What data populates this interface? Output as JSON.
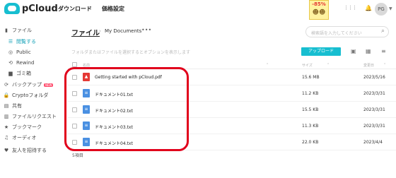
{
  "brand": {
    "logo_text": "pCloud"
  },
  "topnav": {
    "items": [
      "ダウンロード",
      "価格設定"
    ]
  },
  "promo": {
    "percent": "-85%",
    "faces": "☻☻"
  },
  "top_icons": {
    "apps": "⋮⋮⋮",
    "bell": "🔔",
    "help": "?"
  },
  "user": {
    "avatar_initials": "PG",
    "caret": "▼"
  },
  "sidebar": {
    "items": [
      {
        "label": "ファイル",
        "icon": "▮"
      },
      {
        "label": "閲覧する",
        "icon": "☰"
      },
      {
        "label": "Public",
        "icon": "◎"
      },
      {
        "label": "Rewind",
        "icon": "⟲"
      },
      {
        "label": "ゴミ箱",
        "icon": "▆"
      },
      {
        "label": "バックアップ",
        "icon": "⟳",
        "badge": "NEW"
      },
      {
        "label": "Cryptoフォルダ",
        "icon": "🔒"
      },
      {
        "label": "共有",
        "icon": "▤"
      },
      {
        "label": "ファイルリクエスト",
        "icon": "▥"
      },
      {
        "label": "ブックマーク",
        "icon": "★"
      },
      {
        "label": "オーディオ",
        "icon": "♫"
      },
      {
        "label": "友人を招待する",
        "icon": "♥"
      }
    ]
  },
  "breadcrumb": {
    "root": "ファイル",
    "separator": "›",
    "current": "My Documents",
    "more": "•••"
  },
  "search": {
    "placeholder": "検索語を入力してください",
    "icon": "⌕"
  },
  "toolbar": {
    "hint": "フォルダまたはファイルを選択するとオプションを表示します",
    "upload_label": "アップロード",
    "new_folder_icon": "▣",
    "grid_icon": "▦",
    "sort_icon": "≡"
  },
  "table": {
    "columns": {
      "name": "名前",
      "name_sort": "⌃",
      "size": "サイズ",
      "size_sort": "⌃",
      "modified": "変更日",
      "modified_sort": "⌃"
    },
    "rows": [
      {
        "icon": "pdf",
        "icon_glyph": "⬛",
        "name": "Getting started with pCloud.pdf",
        "size": "15.6 MB",
        "date": "2023/5/16"
      },
      {
        "icon": "txt",
        "icon_glyph": "≡",
        "name": "ドキュメント01.txt",
        "size": "11.2 KB",
        "date": "2023/3/31"
      },
      {
        "icon": "txt",
        "icon_glyph": "≡",
        "name": "ドキュメント02.txt",
        "size": "15.5 KB",
        "date": "2023/3/31"
      },
      {
        "icon": "txt",
        "icon_glyph": "≡",
        "name": "ドキュメント03.txt",
        "size": "11.3 KB",
        "date": "2023/3/31"
      },
      {
        "icon": "txt",
        "icon_glyph": "≡",
        "name": "ドキュメント04.txt",
        "size": "22.0 KB",
        "date": "2023/4/4"
      }
    ],
    "item_count": "5項目"
  },
  "annotation": {
    "color": "#e1001c"
  }
}
